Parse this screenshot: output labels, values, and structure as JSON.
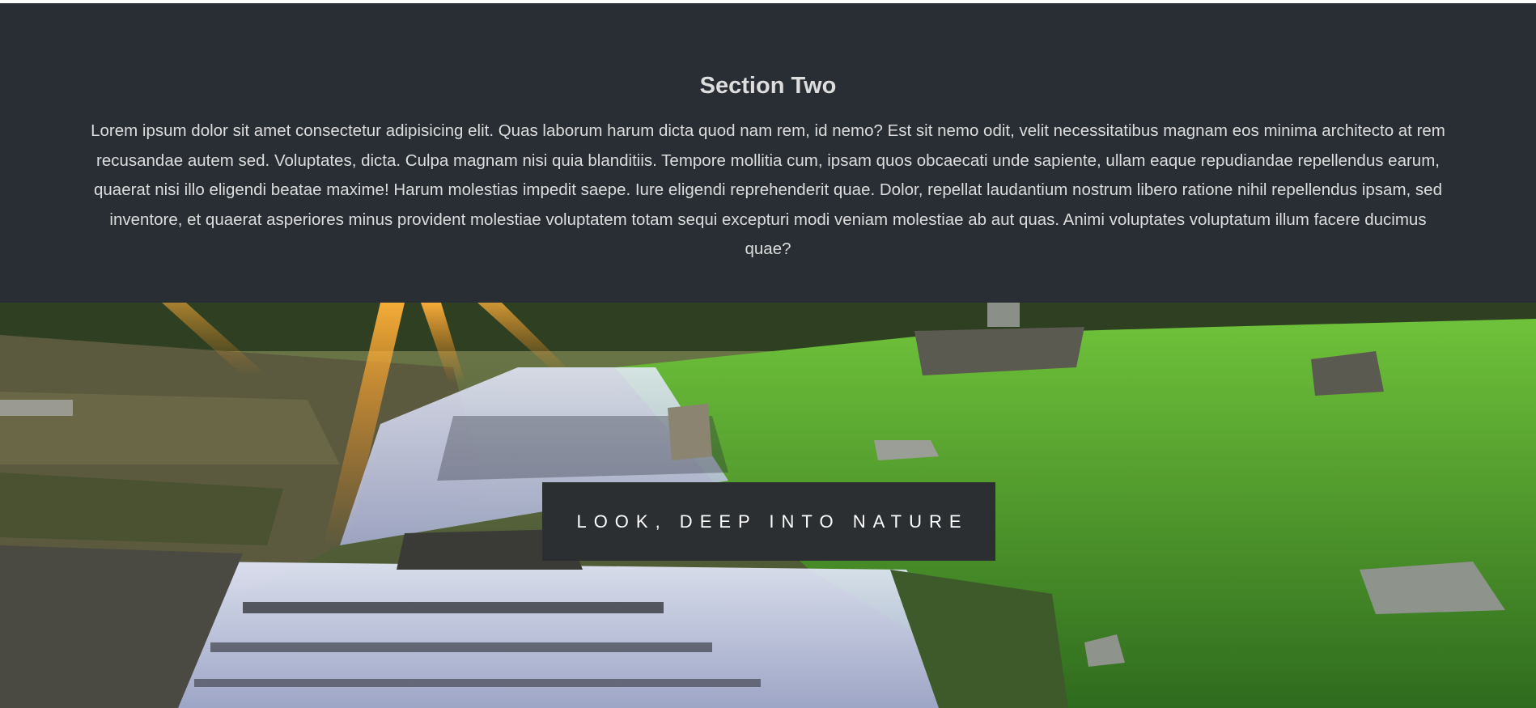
{
  "section_two": {
    "title": "Section Two",
    "body": "Lorem ipsum dolor sit amet consectetur adipisicing elit. Quas laborum harum dicta quod nam rem, id nemo? Est sit nemo odit, velit necessitatibus magnam eos minima architecto at rem recusandae autem sed. Voluptates, dicta. Culpa magnam nisi quia blanditiis. Tempore mollitia cum, ipsam quos obcaecati unde sapiente, ullam eaque repudiandae repellendus earum, quaerat nisi illo eligendi beatae maxime! Harum molestias impedit saepe. Iure eligendi reprehenderit quae. Dolor, repellat laudantium nostrum libero ratione nihil repellendus ipsam, sed inventore, et quaerat asperiores minus provident molestiae voluptatem totam sequi excepturi modi veniam molestiae ab aut quas. Animi voluptates voluptatum illum facere ducimus quae?",
    "background_color": "#282e34",
    "text_color": "#dddddd"
  },
  "hero": {
    "caption": "Look, deep into nature",
    "caption_background": "#2b2f31",
    "caption_text_color": "#ffffff"
  }
}
